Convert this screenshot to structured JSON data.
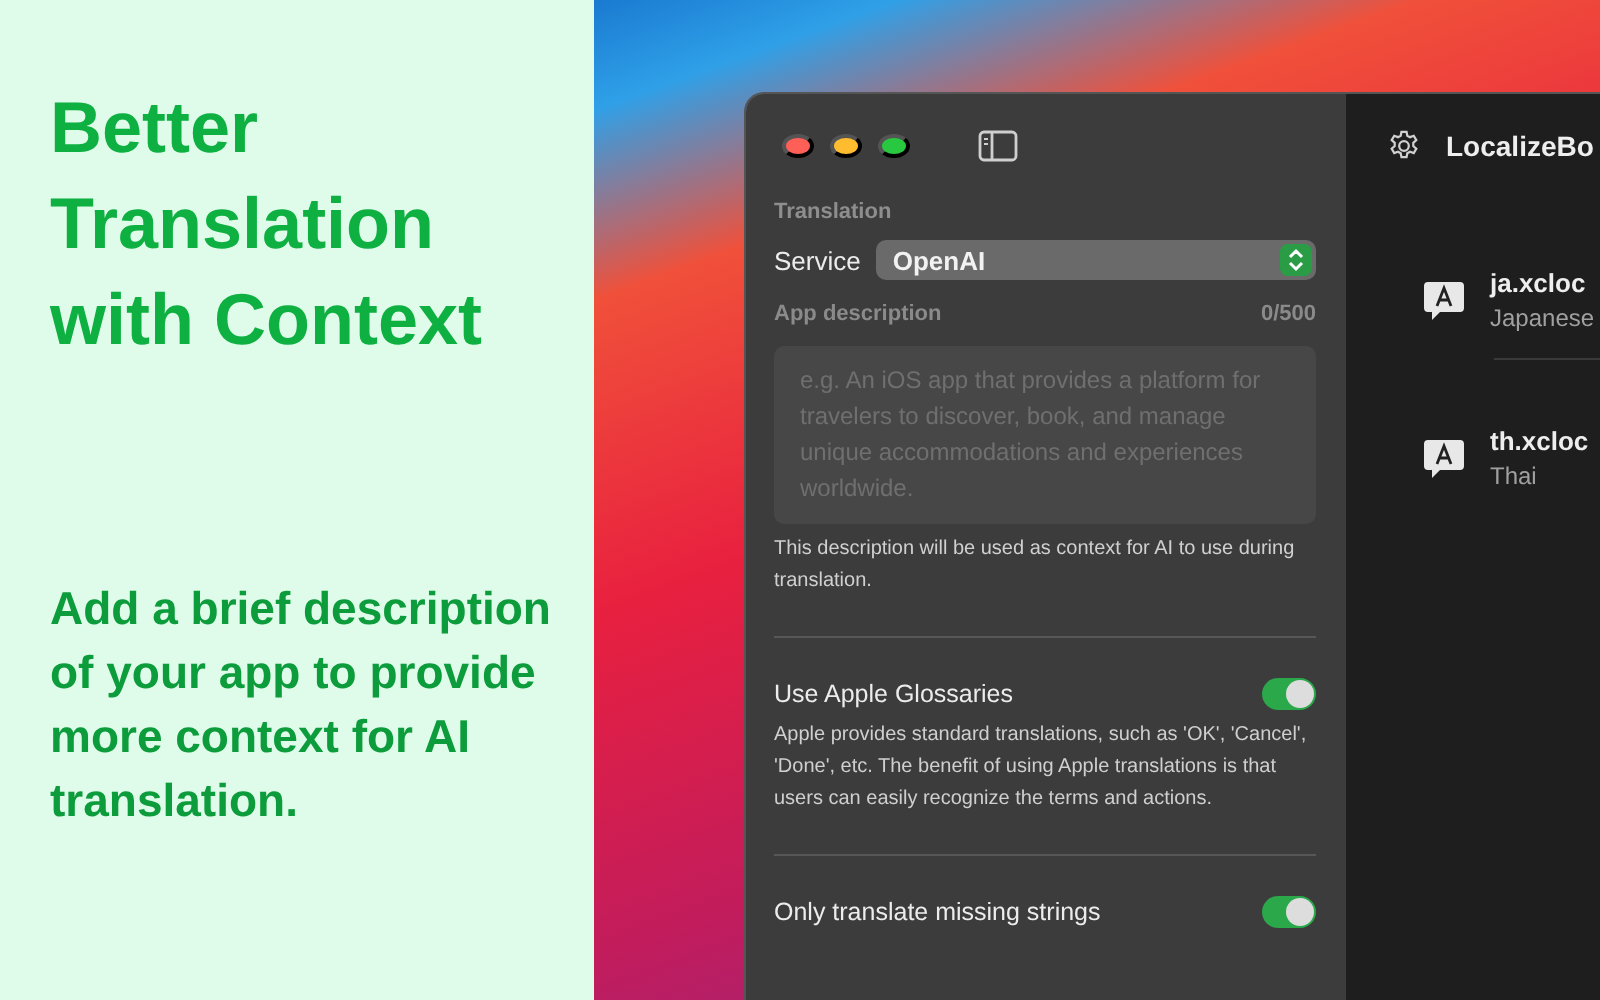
{
  "promo": {
    "headline": "Better Translation with Context",
    "subtitle": "Add a brief description of your app to provide more context for AI translation."
  },
  "sidebar": {
    "section_label": "Translation",
    "service": {
      "label": "Service",
      "value": "OpenAI"
    },
    "description": {
      "label": "App description",
      "counter": "0/500",
      "placeholder": "e.g. An iOS app that provides a platform for travelers to discover, book, and manage unique accommodations and experiences worldwide.",
      "caption": "This description will be used as context for AI to use during translation."
    },
    "toggles": [
      {
        "label": "Use Apple Glossaries",
        "on": true,
        "description": "Apple provides standard translations, such as 'OK', 'Cancel', 'Done', etc. The benefit of using Apple translations is that users can easily recognize the terms and actions."
      },
      {
        "label": "Only translate missing strings",
        "on": true
      }
    ]
  },
  "detail": {
    "title": "LocalizeBo",
    "files": [
      {
        "name": "ja.xcloc",
        "language": "Japanese"
      },
      {
        "name": "th.xcloc",
        "language": "Thai"
      }
    ]
  }
}
